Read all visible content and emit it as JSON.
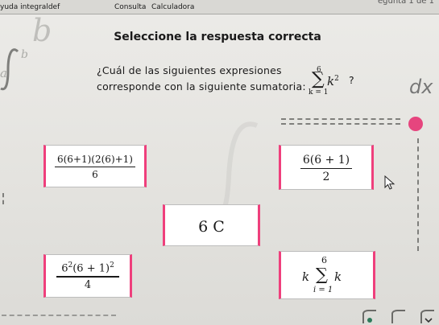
{
  "menu": {
    "left_label": "yuda integraldef",
    "item_1": "Consulta",
    "item_2": "Calculadora",
    "top_right": "egunta 1 de 1"
  },
  "title": "Seleccione la respuesta correcta",
  "question": {
    "line_1": "¿Cuál de las siguientes expresiones",
    "line_2": "corresponde con la siguiente sumatoria:",
    "sum_upper": "6",
    "sum_symbol": "∑",
    "sum_term": "k",
    "sum_exponent": "2",
    "sum_lower": "k = 1",
    "question_mark": "?"
  },
  "decorations": {
    "dx_text": "dx",
    "watermark_b": "b",
    "watermark_a": "a",
    "watermark_d": "d",
    "accent_pink": "#ef3f7c",
    "dot_pink": "#e6457e"
  },
  "options": [
    {
      "numerator": "6(6+1)(2(6)+1)",
      "denominator": "6"
    },
    {
      "numerator": "6(6 + 1)",
      "denominator": "2"
    },
    {
      "text": "6 C"
    },
    {
      "numerator_base": "6",
      "numerator_exp": "2",
      "numerator_mid": "(6 + 1)",
      "numerator_exp2": "2",
      "denominator": "4"
    },
    {
      "prefix": "k",
      "upper": "6",
      "symbol": "∑",
      "term": "k",
      "lower": "i = 1"
    }
  ],
  "icons": [
    "integral-watermark-icon",
    "cursor-arrow-icon",
    "bookmark-icon"
  ]
}
